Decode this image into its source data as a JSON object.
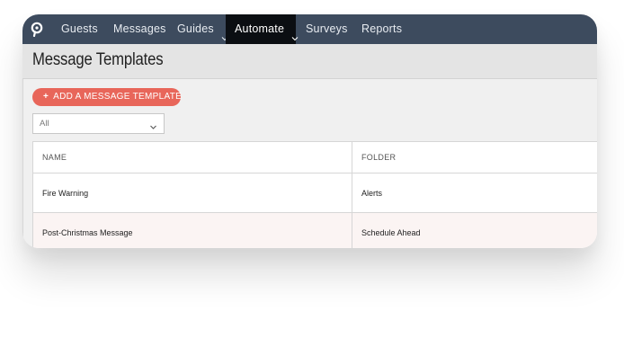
{
  "nav": {
    "items": [
      {
        "label": "Guests"
      },
      {
        "label": "Messages"
      },
      {
        "label": "Guides"
      },
      {
        "label": "Automate"
      },
      {
        "label": "Surveys"
      },
      {
        "label": "Reports"
      }
    ],
    "active": "Automate"
  },
  "page": {
    "title": "Message Templates"
  },
  "toolbar": {
    "add_button_label": "ADD A MESSAGE TEMPLATE",
    "add_button_icon": "plus-icon",
    "filter_value": "All"
  },
  "table": {
    "columns": [
      "NAME",
      "FOLDER"
    ],
    "rows": [
      {
        "name": "Fire Warning",
        "folder": "Alerts"
      },
      {
        "name": "Post-Christmas Message",
        "folder": "Schedule Ahead"
      }
    ]
  },
  "colors": {
    "nav_bg": "#3d4b5e",
    "nav_active_bg": "#0b0e12",
    "accent": "#e8665a",
    "row_highlight": "#fbf4f3"
  }
}
